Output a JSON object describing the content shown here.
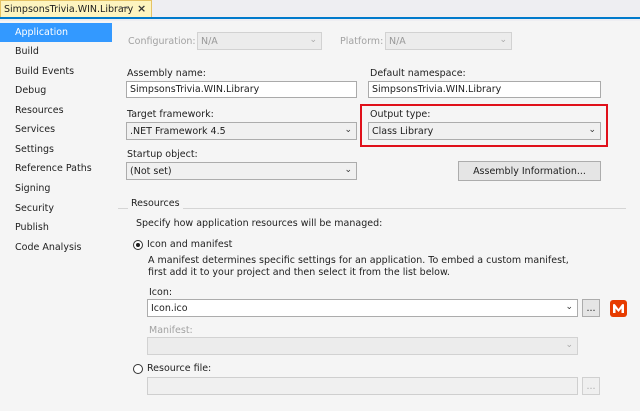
{
  "tab": {
    "title": "SimpsonsTrivia.WIN.Library",
    "pin_glyph": "⊸",
    "close_glyph": "×"
  },
  "nav": {
    "items": [
      {
        "label": "Application",
        "active": true
      },
      {
        "label": "Build"
      },
      {
        "label": "Build Events"
      },
      {
        "label": "Debug"
      },
      {
        "label": "Resources"
      },
      {
        "label": "Services"
      },
      {
        "label": "Settings"
      },
      {
        "label": "Reference Paths"
      },
      {
        "label": "Signing"
      },
      {
        "label": "Security"
      },
      {
        "label": "Publish"
      },
      {
        "label": "Code Analysis"
      }
    ]
  },
  "config": {
    "configuration_label": "Configuration:",
    "configuration_value": "N/A",
    "platform_label": "Platform:",
    "platform_value": "N/A"
  },
  "form": {
    "assembly_name_label": "Assembly name:",
    "assembly_name_value": "SimpsonsTrivia.WIN.Library",
    "default_namespace_label": "Default namespace:",
    "default_namespace_value": "SimpsonsTrivia.WIN.Library",
    "target_framework_label": "Target framework:",
    "target_framework_value": ".NET Framework 4.5",
    "output_type_label": "Output type:",
    "output_type_value": "Class Library",
    "startup_object_label": "Startup object:",
    "startup_object_value": "(Not set)",
    "assembly_info_button": "Assembly Information..."
  },
  "resources": {
    "group_label": "Resources",
    "intro": "Specify how application resources will be managed:",
    "icon_manifest_option": "Icon and manifest",
    "description": "A manifest determines specific settings for an application. To embed a custom manifest, first add it to your project and then select it from the list below.",
    "icon_label": "Icon:",
    "icon_value": "Icon.ico",
    "browse_label": "...",
    "manifest_label": "Manifest:",
    "manifest_value": "",
    "resource_file_option": "Resource file:",
    "resource_file_value": "",
    "resource_browse_label": "..."
  },
  "colors": {
    "accent": "#007acc",
    "selected_nav": "#3399ff",
    "highlight": "#e0101a",
    "icon_badge": "#e73c00"
  }
}
